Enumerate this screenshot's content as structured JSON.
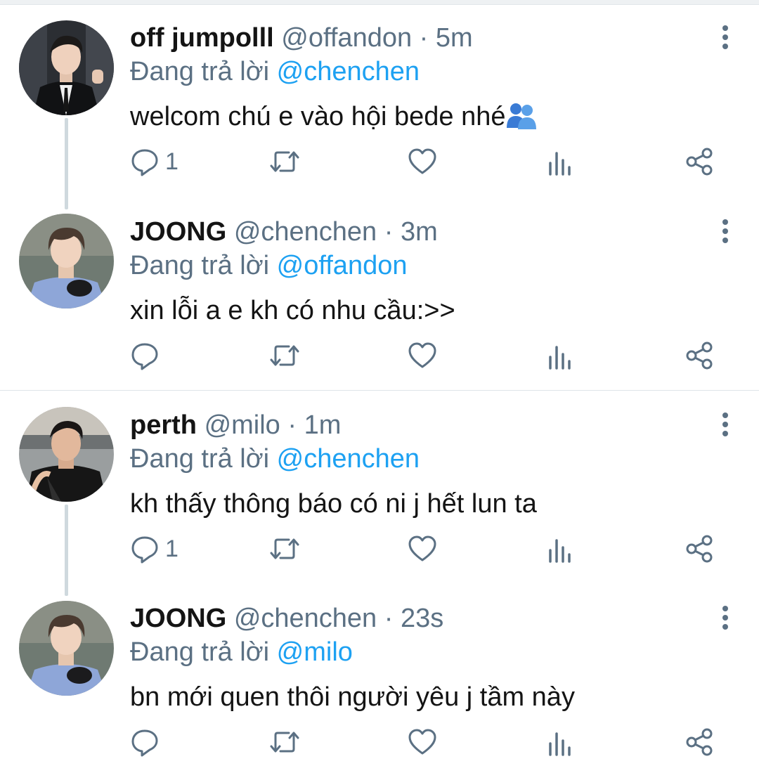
{
  "tweets": [
    {
      "name": "off jumpolll",
      "handle": "@offandon",
      "time": "5m",
      "reply_prefix": "Đang trả lời",
      "reply_to": "@chenchen",
      "text": "welcom chú e vào hội bede nhé",
      "reply_count": "1",
      "emoji": "two-people-emoji"
    },
    {
      "name": "JOONG",
      "handle": "@chenchen",
      "time": "3m",
      "reply_prefix": "Đang trả lời",
      "reply_to": "@offandon",
      "text": "xin lỗi a e kh có nhu cầu:>>",
      "reply_count": ""
    },
    {
      "name": "perth",
      "handle": "@milo",
      "time": "1m",
      "reply_prefix": "Đang trả lời",
      "reply_to": "@chenchen",
      "text": "kh thấy thông báo có ni j hết lun ta",
      "reply_count": "1"
    },
    {
      "name": "JOONG",
      "handle": "@chenchen",
      "time": "23s",
      "reply_prefix": "Đang trả lời",
      "reply_to": "@milo",
      "text": "bn mới quen thôi người yêu j tầm này",
      "reply_count": ""
    }
  ],
  "separator": "·",
  "colors": {
    "mention": "#1da1f2",
    "secondary": "#5b7083",
    "thread_line": "#cfd9de"
  },
  "icons": [
    "reply-icon",
    "retweet-icon",
    "like-icon",
    "analytics-icon",
    "share-icon",
    "more-icon"
  ]
}
